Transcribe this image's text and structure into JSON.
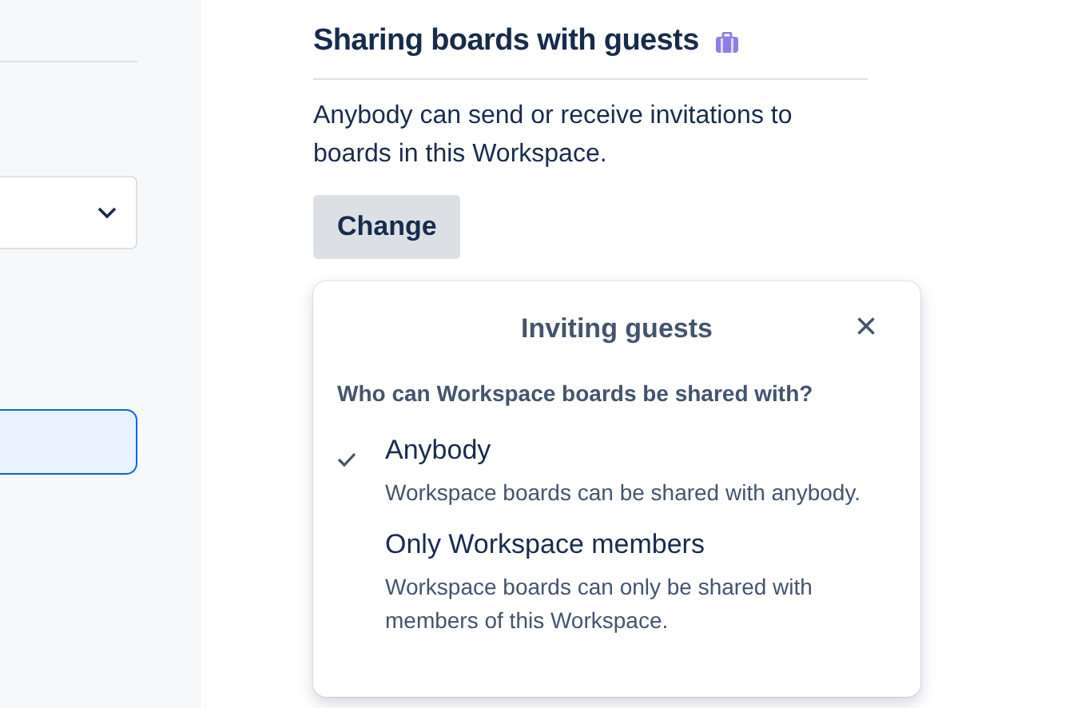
{
  "section": {
    "title": "Sharing boards with guests",
    "description": "Anybody can send or receive invitations to boards in this Workspace.",
    "button": "Change"
  },
  "popover": {
    "title": "Inviting guests",
    "close": "×",
    "question": "Who can Workspace boards be shared with?",
    "options": [
      {
        "label": "Anybody",
        "description": "Workspace boards can be shared with anybody.",
        "selected": true
      },
      {
        "label": "Only Workspace members",
        "description": "Workspace boards can only be shared with members of this Workspace.",
        "selected": false
      }
    ]
  }
}
